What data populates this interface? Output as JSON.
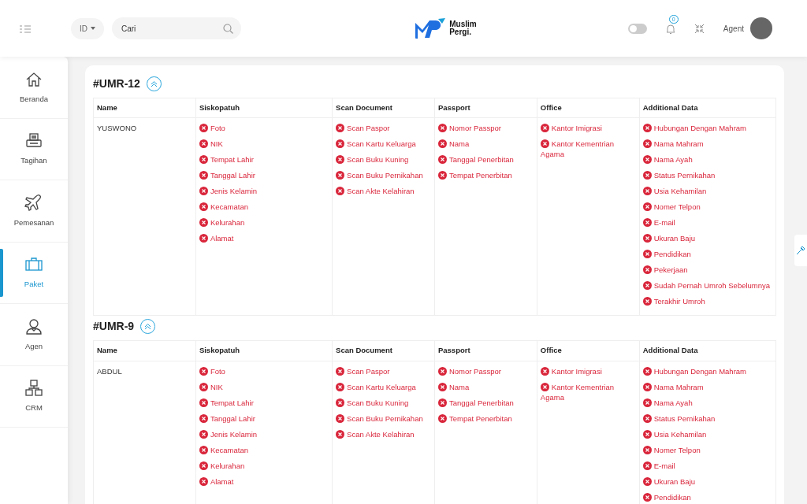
{
  "header": {
    "language": "ID",
    "search": {
      "placeholder": "Cari"
    },
    "logo_text": [
      "Muslim",
      "Pergi."
    ],
    "dark_mode_toggle": {
      "on": false
    },
    "notifications": {
      "count": "0"
    },
    "user": {
      "name": "Agent"
    }
  },
  "sidebar": {
    "items": [
      {
        "label": "Beranda",
        "selected": false
      },
      {
        "label": "Tagihan",
        "selected": false
      },
      {
        "label": "Pemesanan",
        "selected": false
      },
      {
        "label": "Paket",
        "selected": true
      },
      {
        "label": "Agen",
        "selected": false
      },
      {
        "label": "CRM",
        "selected": false
      }
    ]
  },
  "groups": [
    {
      "code": "#UMR-12",
      "expanded": true,
      "columns": [
        "Name",
        "Siskopatuh",
        "Scan Document",
        "Passport",
        "Office",
        "Additional Data"
      ],
      "rows": [
        {
          "name": "YUSWONO",
          "checks": [
            [
              {
                "label": "Foto",
                "complete": false
              },
              {
                "label": "NIK",
                "complete": false
              },
              {
                "label": "Tempat Lahir",
                "complete": false
              },
              {
                "label": "Tanggal Lahir",
                "complete": false
              },
              {
                "label": "Jenis Kelamin",
                "complete": false
              },
              {
                "label": "Kecamatan",
                "complete": false
              },
              {
                "label": "Kelurahan",
                "complete": false
              },
              {
                "label": "Alamat",
                "complete": false
              }
            ],
            [
              {
                "label": "Scan Paspor",
                "complete": false
              },
              {
                "label": "Scan Kartu Keluarga",
                "complete": false
              },
              {
                "label": "Scan Buku Kuning",
                "complete": false
              },
              {
                "label": "Scan Buku Pernikahan",
                "complete": false
              },
              {
                "label": "Scan Akte Kelahiran",
                "complete": false
              }
            ],
            [
              {
                "label": "Nomor Passpor",
                "complete": false
              },
              {
                "label": "Nama",
                "complete": false
              },
              {
                "label": "Tanggal Penerbitan",
                "complete": false
              },
              {
                "label": "Tempat Penerbitan",
                "complete": false
              }
            ],
            [
              {
                "label": "Kantor Imigrasi",
                "complete": false
              },
              {
                "label": "Kantor Kementrian Agama",
                "complete": false
              }
            ],
            [
              {
                "label": "Hubungan Dengan Mahram",
                "complete": false
              },
              {
                "label": "Nama Mahram",
                "complete": false
              },
              {
                "label": "Nama Ayah",
                "complete": false
              },
              {
                "label": "Status Pernikahan",
                "complete": false
              },
              {
                "label": "Usia Kehamilan",
                "complete": false
              },
              {
                "label": "Nomer Telpon",
                "complete": false
              },
              {
                "label": "E-mail",
                "complete": false
              },
              {
                "label": "Ukuran Baju",
                "complete": false
              },
              {
                "label": "Pendidikan",
                "complete": false
              },
              {
                "label": "Pekerjaan",
                "complete": false
              },
              {
                "label": "Sudah Pernah Umroh Sebelumnya",
                "complete": false
              },
              {
                "label": "Terakhir Umroh",
                "complete": false
              }
            ]
          ]
        }
      ]
    },
    {
      "code": "#UMR-9",
      "expanded": true,
      "columns": [
        "Name",
        "Siskopatuh",
        "Scan Document",
        "Passport",
        "Office",
        "Additional Data"
      ],
      "rows": [
        {
          "name": "ABDUL",
          "checks": [
            [
              {
                "label": "Foto",
                "complete": false
              },
              {
                "label": "NIK",
                "complete": false
              },
              {
                "label": "Tempat Lahir",
                "complete": false
              },
              {
                "label": "Tanggal Lahir",
                "complete": false
              },
              {
                "label": "Jenis Kelamin",
                "complete": false
              },
              {
                "label": "Kecamatan",
                "complete": false
              },
              {
                "label": "Kelurahan",
                "complete": false
              },
              {
                "label": "Alamat",
                "complete": false
              }
            ],
            [
              {
                "label": "Scan Paspor",
                "complete": false
              },
              {
                "label": "Scan Kartu Keluarga",
                "complete": false
              },
              {
                "label": "Scan Buku Kuning",
                "complete": false
              },
              {
                "label": "Scan Buku Pernikahan",
                "complete": false
              },
              {
                "label": "Scan Akte Kelahiran",
                "complete": false
              }
            ],
            [
              {
                "label": "Nomor Passpor",
                "complete": false
              },
              {
                "label": "Nama",
                "complete": false
              },
              {
                "label": "Tanggal Penerbitan",
                "complete": false
              },
              {
                "label": "Tempat Penerbitan",
                "complete": false
              }
            ],
            [
              {
                "label": "Kantor Imigrasi",
                "complete": false
              },
              {
                "label": "Kantor Kementrian Agama",
                "complete": false
              }
            ],
            [
              {
                "label": "Hubungan Dengan Mahram",
                "complete": false
              },
              {
                "label": "Nama Mahram",
                "complete": false
              },
              {
                "label": "Nama Ayah",
                "complete": false
              },
              {
                "label": "Status Pernikahan",
                "complete": false
              },
              {
                "label": "Usia Kehamilan",
                "complete": false
              },
              {
                "label": "Nomer Telpon",
                "complete": false
              },
              {
                "label": "E-mail",
                "complete": false
              },
              {
                "label": "Ukuran Baju",
                "complete": false
              },
              {
                "label": "Pendidikan",
                "complete": false
              }
            ]
          ]
        }
      ]
    }
  ]
}
